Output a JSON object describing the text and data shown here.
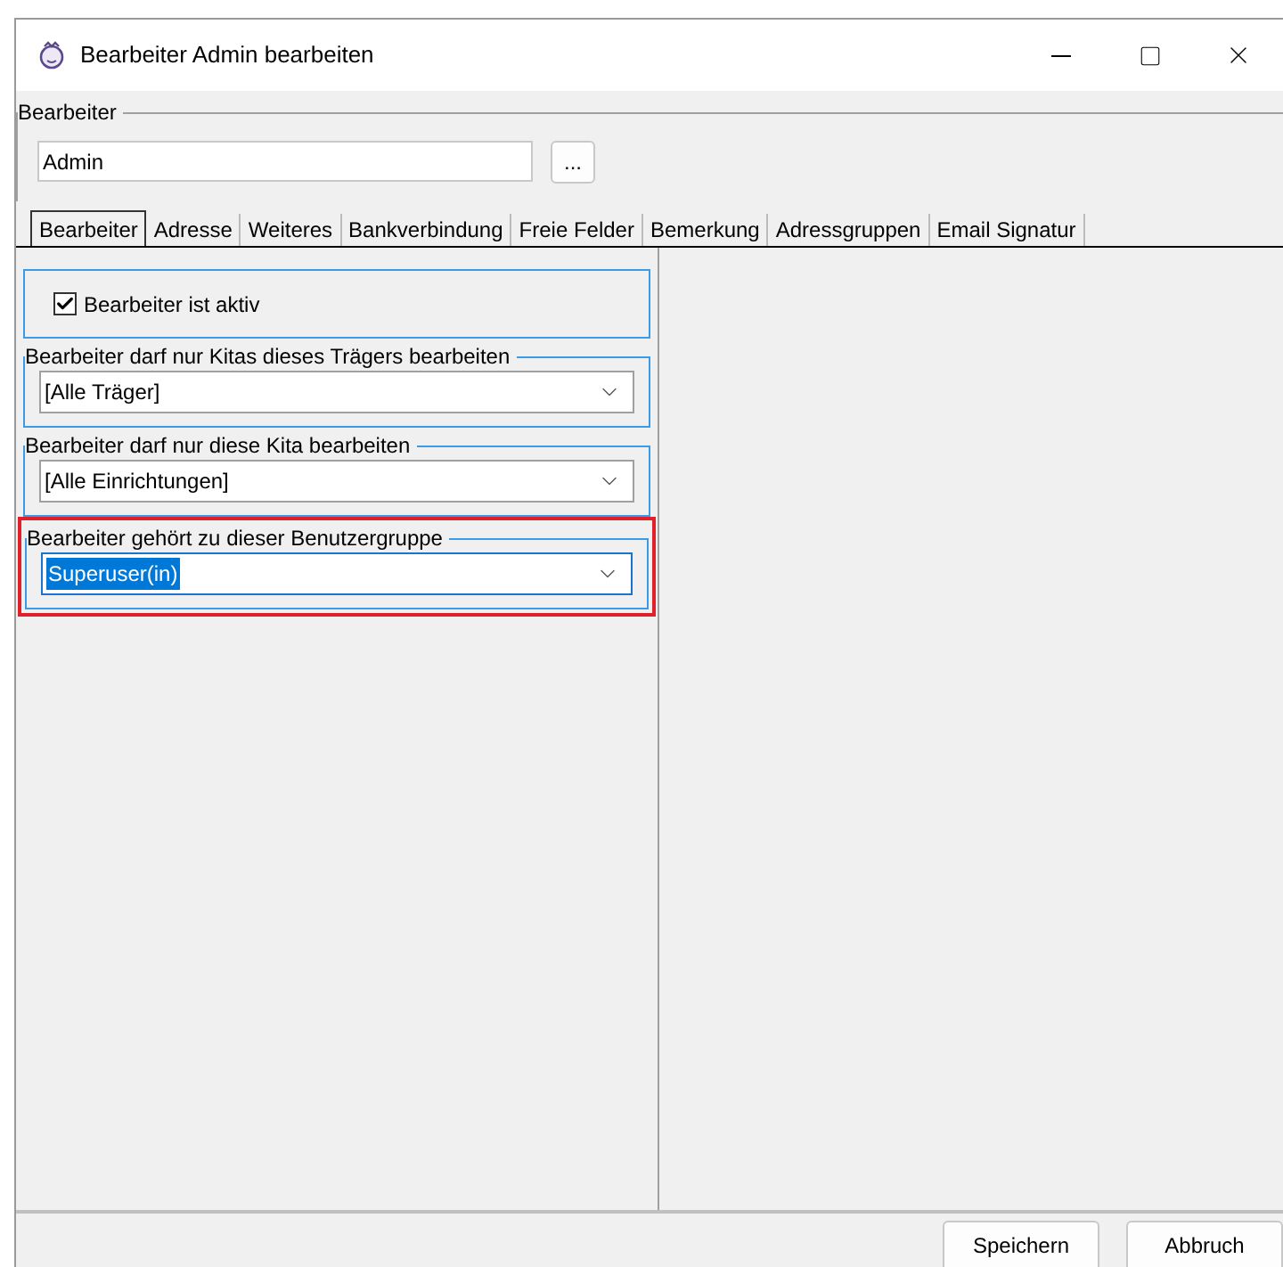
{
  "window": {
    "title": "Bearbeiter Admin bearbeiten"
  },
  "bearbeiter_group": {
    "legend": "Bearbeiter",
    "value": "Admin",
    "browse_button": "..."
  },
  "tabs": [
    {
      "label": "Bearbeiter",
      "selected": true
    },
    {
      "label": "Adresse",
      "selected": false
    },
    {
      "label": "Weiteres",
      "selected": false
    },
    {
      "label": "Bankverbindung",
      "selected": false
    },
    {
      "label": "Freie Felder",
      "selected": false
    },
    {
      "label": "Bemerkung",
      "selected": false
    },
    {
      "label": "Adressgruppen",
      "selected": false
    },
    {
      "label": "Email Signatur",
      "selected": false
    }
  ],
  "active_checkbox": {
    "label": "Bearbeiter ist aktiv",
    "checked": true
  },
  "groups": [
    {
      "legend": "Bearbeiter darf nur Kitas dieses Trägers bearbeiten",
      "value": "[Alle Träger]",
      "focused": false,
      "highlighted": false
    },
    {
      "legend": "Bearbeiter darf nur diese Kita bearbeiten",
      "value": "[Alle Einrichtungen]",
      "focused": false,
      "highlighted": false
    },
    {
      "legend": "Bearbeiter gehört zu dieser Benutzergruppe",
      "value": "Superuser(in)",
      "focused": true,
      "highlighted": true
    }
  ],
  "buttons": [
    "Speichern",
    "Abbruch"
  ]
}
